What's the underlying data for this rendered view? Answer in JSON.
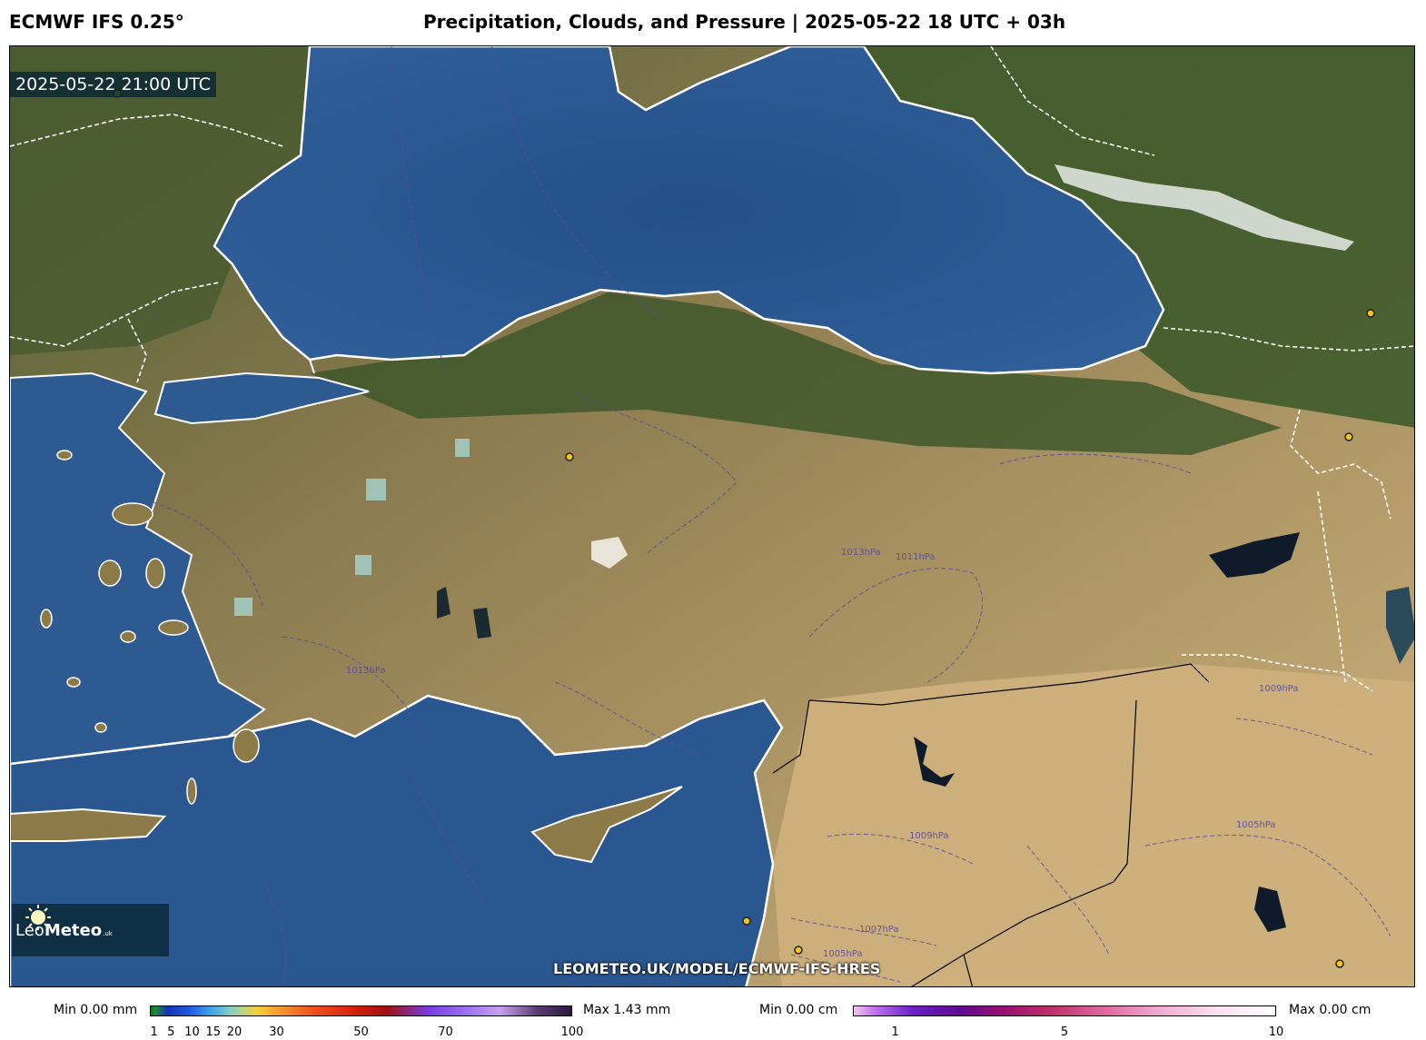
{
  "header": {
    "model": "ECMWF IFS 0.25°",
    "title": "Precipitation, Clouds, and Pressure | 2025-05-22 18 UTC + 03h"
  },
  "map": {
    "valid_time": "2025-05-22 21:00 UTC",
    "logo_main": "Leo",
    "logo_bold": "Meteo",
    "logo_suffix": ".uk",
    "url": "LEOMETEO.UK/MODEL/ECMWF-IFS-HRES",
    "isobar_labels": [
      "1013hPa",
      "1011hPa",
      "1009hPa",
      "1007hPa",
      "1005hPa"
    ]
  },
  "colorbars": {
    "precip": {
      "min_label": "Min 0.00 mm",
      "max_label": "Max 1.43 mm",
      "ticks": [
        "1",
        "5",
        "10",
        "15",
        "20",
        "30",
        "50",
        "70",
        "100"
      ]
    },
    "snow": {
      "min_label": "Min 0.00 cm",
      "max_label": "Max 0.00 cm",
      "ticks": [
        "1",
        "5",
        "10"
      ]
    }
  },
  "colors": {
    "sea": "#2d5a90",
    "land": "#8a7a4e",
    "forest": "#3c5a2a",
    "desert": "#c8ae7c",
    "coast": "#ffffff",
    "isobar": "#5a4a9a"
  }
}
